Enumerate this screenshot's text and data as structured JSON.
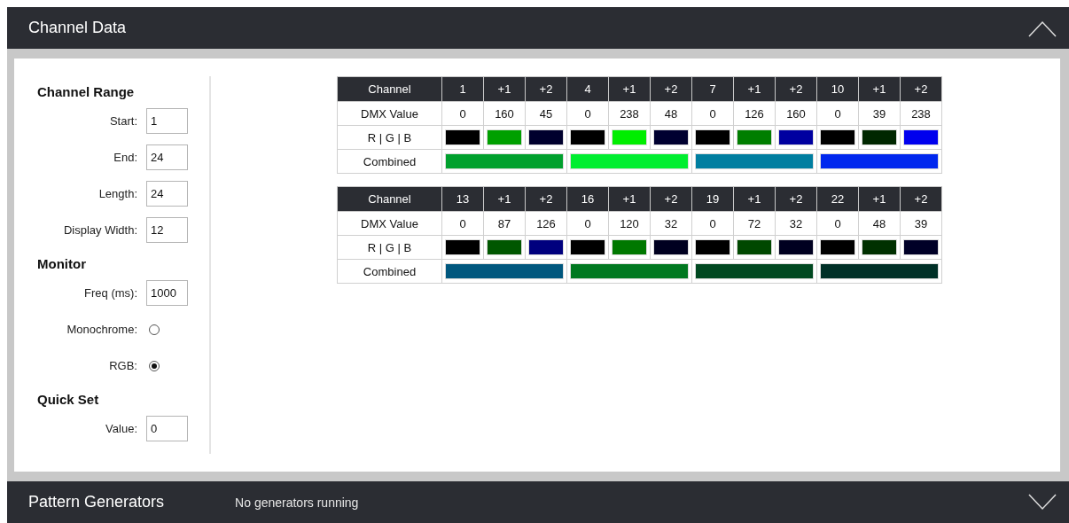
{
  "channel_panel": {
    "title": "Channel Data",
    "expanded": true
  },
  "sections": [
    {
      "heading": "Channel Range",
      "fields": [
        {
          "kind": "input",
          "label": "Start:",
          "value": "1"
        },
        {
          "kind": "input",
          "label": "End:",
          "value": "24"
        },
        {
          "kind": "input",
          "label": "Length:",
          "value": "24"
        },
        {
          "kind": "input",
          "label": "Display Width:",
          "value": "12"
        }
      ]
    },
    {
      "heading": "Monitor",
      "fields": [
        {
          "kind": "input",
          "label": "Freq (ms):",
          "value": "1000"
        },
        {
          "kind": "radio",
          "label": "Monochrome:",
          "selected": false
        },
        {
          "kind": "radio",
          "label": "RGB:",
          "selected": true
        }
      ]
    },
    {
      "heading": "Quick Set",
      "fields": [
        {
          "kind": "input",
          "label": "Value:",
          "value": "0"
        }
      ]
    }
  ],
  "tables": [
    {
      "channel_label": "Channel",
      "channels": [
        "1",
        "+1",
        "+2",
        "4",
        "+1",
        "+2",
        "7",
        "+1",
        "+2",
        "10",
        "+1",
        "+2"
      ],
      "dmx_label": "DMX Value",
      "dmx_values": [
        "0",
        "160",
        "45",
        "0",
        "238",
        "48",
        "0",
        "126",
        "160",
        "0",
        "39",
        "238"
      ],
      "rgb_label": "R | G | B",
      "rgb": [
        {
          "color": "#000000"
        },
        {
          "color": "#00a000"
        },
        {
          "color": "#00002d"
        },
        {
          "color": "#000000"
        },
        {
          "color": "#00ee00"
        },
        {
          "color": "#000030"
        },
        {
          "color": "#000000"
        },
        {
          "color": "#007e00"
        },
        {
          "color": "#0000a0"
        },
        {
          "color": "#000000"
        },
        {
          "color": "#002700"
        },
        {
          "color": "#0000ee"
        }
      ],
      "combined_label": "Combined",
      "combined": [
        {
          "color": "#00a02d"
        },
        {
          "color": "#00ee30"
        },
        {
          "color": "#007ea0"
        },
        {
          "color": "#0027ee"
        }
      ]
    },
    {
      "channel_label": "Channel",
      "channels": [
        "13",
        "+1",
        "+2",
        "16",
        "+1",
        "+2",
        "19",
        "+1",
        "+2",
        "22",
        "+1",
        "+2"
      ],
      "dmx_label": "DMX Value",
      "dmx_values": [
        "0",
        "87",
        "126",
        "0",
        "120",
        "32",
        "0",
        "72",
        "32",
        "0",
        "48",
        "39"
      ],
      "rgb_label": "R | G | B",
      "rgb": [
        {
          "color": "#000000"
        },
        {
          "color": "#005700"
        },
        {
          "color": "#00007e"
        },
        {
          "color": "#000000"
        },
        {
          "color": "#007800"
        },
        {
          "color": "#000020"
        },
        {
          "color": "#000000"
        },
        {
          "color": "#004800"
        },
        {
          "color": "#000020"
        },
        {
          "color": "#000000"
        },
        {
          "color": "#003000"
        },
        {
          "color": "#000027"
        }
      ],
      "combined_label": "Combined",
      "combined": [
        {
          "color": "#00577e"
        },
        {
          "color": "#007820"
        },
        {
          "color": "#004820"
        },
        {
          "color": "#003027"
        }
      ]
    }
  ],
  "pattern_panel": {
    "title": "Pattern Generators",
    "status": "No generators running",
    "expanded": false
  }
}
